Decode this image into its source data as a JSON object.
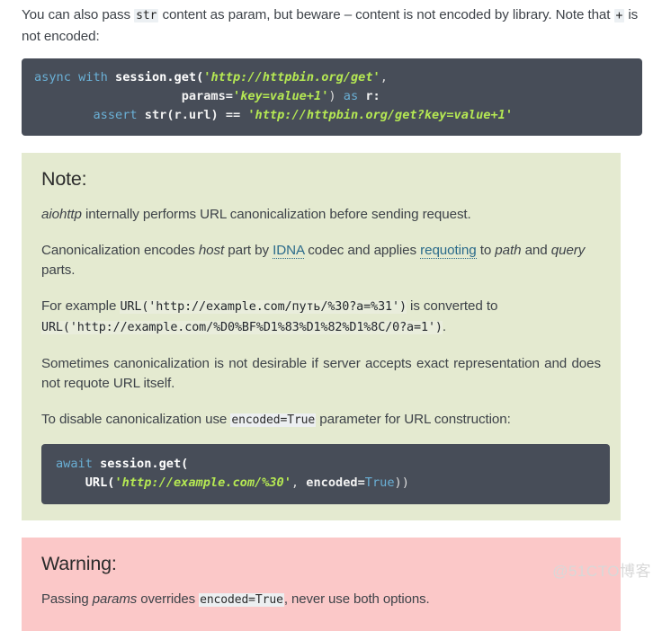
{
  "intro": {
    "line1_part1": "You can also pass ",
    "line1_code": "str",
    "line1_part2": " content as param, but beware – content is not encoded by library.",
    "line2_part1": "Note that ",
    "line2_code": "+",
    "line2_part2": " is not encoded:"
  },
  "code_top": {
    "line1_kw_async": "async",
    "line1_kw_with": "with",
    "line1_name": "session.get(",
    "line1_str": "'http://httpbin.org/get'",
    "line1_comma": ",",
    "line2_indent": "                    ",
    "line2_param": "params=",
    "line2_str": "'key=value+1'",
    "line2_close": ")",
    "line2_kw_as": "as",
    "line2_var": "r:",
    "line3_indent": "        ",
    "line3_kw_assert": "assert",
    "line3_call": "str(r.url)",
    "line3_op": "==",
    "line3_str": "'http://httpbin.org/get?key=value+1'"
  },
  "note": {
    "title": "Note:",
    "p1_em": "aiohttp",
    "p1_rest": " internally performs URL canonicalization before sending request.",
    "p2_a": "Canonicalization encodes ",
    "p2_em1": "host",
    "p2_b": " part by ",
    "p2_link1": "IDNA",
    "p2_c": " codec and applies ",
    "p2_link2": "requoting",
    "p2_d": " to ",
    "p2_em2": "path",
    "p2_e": " and ",
    "p2_em3": "query",
    "p2_f": " parts.",
    "p3_a": "For example ",
    "p3_code1": "URL('http://example.com/путь/%30?a=%31')",
    "p3_b": " is converted to ",
    "p3_code2": "URL('http://example.com/%D0%BF%D1%83%D1%82%D1%8C/0?a=1')",
    "p3_c": ".",
    "p4": "Sometimes canonicalization is not desirable if server accepts exact representation and does not requote URL itself.",
    "p5_a": "To disable canonicalization use ",
    "p5_code": "encoded=True",
    "p5_b": " parameter for URL construction:",
    "code": {
      "line1_kw": "await",
      "line1_name": "session.get(",
      "line2_indent": "    ",
      "line2_fn": "URL(",
      "line2_str": "'http://example.com/%30'",
      "line2_comma": ", ",
      "line2_param": "encoded=",
      "line2_const": "True",
      "line2_close": "))"
    }
  },
  "warning": {
    "title": "Warning:",
    "p1_a": "Passing ",
    "p1_em": "params",
    "p1_b": " overrides ",
    "p1_code": "encoded=True",
    "p1_c": ", never use both options."
  },
  "watermark": "@51CTO博客",
  "colors": {
    "note_bg": "#e4ead0",
    "warning_bg": "#fbc8c8",
    "code_bg": "#474d58",
    "link": "#2a6a8a",
    "code_string": "#b5e853",
    "code_keyword": "#6ab0d6",
    "text": "#3e4349"
  }
}
